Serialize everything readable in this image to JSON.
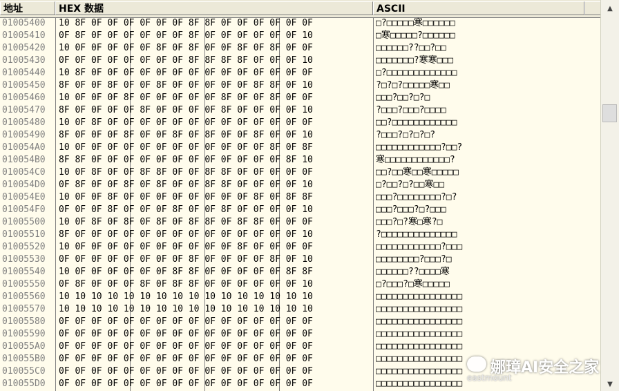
{
  "header": {
    "addr": "地址",
    "hex": "HEX 数据",
    "ascii": "ASCII"
  },
  "rows": [
    {
      "a": "01005400",
      "h": "10 8F 0F 0F 0F 0F 0F 0F 8F 8F 0F 0F 0F 0F 0F 0F",
      "s": "□?□□□□□寒□□□□□□"
    },
    {
      "a": "01005410",
      "h": "0F 8F 0F 0F 0F 0F 0F 0F 8F 0F 0F 0F 0F 0F 0F 10",
      "s": "□寒□□□□□?□□□□□□"
    },
    {
      "a": "01005420",
      "h": "10 0F 0F 0F 0F 0F 8F 0F 8F 0F 0F 8F 0F 8F 0F 0F",
      "s": "□□□□□□??□□?□□"
    },
    {
      "a": "01005430",
      "h": "0F 0F 0F 0F 0F 0F 0F 0F 8F 8F 8F 8F 0F 0F 0F 10",
      "s": "□□□□□□□?寒寒□□□"
    },
    {
      "a": "01005440",
      "h": "10 8F 0F 0F 0F 0F 0F 0F 0F 0F 0F 0F 0F 0F 0F 0F",
      "s": "□?□□□□□□□□□□□□□"
    },
    {
      "a": "01005450",
      "h": "8F 0F 0F 8F 0F 0F 8F 0F 0F 0F 0F 0F 8F 8F 0F 10",
      "s": "?□?□?□□□□□寒□□"
    },
    {
      "a": "01005460",
      "h": "10 0F 0F 0F 8F 0F 0F 0F 0F 0F 8F 0F 0F 8F 0F 0F",
      "s": "□□□?□□?□?□"
    },
    {
      "a": "01005470",
      "h": "8F 0F 0F 0F 0F 8F 0F 0F 0F 0F 8F 0F 0F 0F 0F 10",
      "s": "?□□□?□□□?□□□□"
    },
    {
      "a": "01005480",
      "h": "10 0F 8F 0F 0F 0F 0F 0F 0F 0F 0F 0F 0F 0F 0F 0F",
      "s": "□□?□□□□□□□□□□□□"
    },
    {
      "a": "01005490",
      "h": "8F 0F 0F 0F 8F 0F 0F 8F 0F 8F 0F 0F 8F 0F 0F 10",
      "s": "?□□□?□?□?□?"
    },
    {
      "a": "010054A0",
      "h": "10 0F 0F 0F 0F 0F 0F 0F 0F 0F 0F 0F 0F 8F 0F 8F",
      "s": "□□□□□□□□□□□□?□□?"
    },
    {
      "a": "010054B0",
      "h": "8F 8F 0F 0F 0F 0F 0F 0F 0F 0F 0F 0F 0F 0F 8F 10",
      "s": "寒□□□□□□□□□□□□?"
    },
    {
      "a": "010054C0",
      "h": "10 0F 8F 0F 0F 8F 8F 0F 0F 8F 8F 0F 0F 0F 0F 0F",
      "s": "□□?□□寒□□寒□□□□□"
    },
    {
      "a": "010054D0",
      "h": "0F 8F 0F 0F 8F 0F 8F 0F 0F 8F 8F 0F 0F 0F 0F 10",
      "s": "□?□□?□?□□寒□□"
    },
    {
      "a": "010054E0",
      "h": "10 0F 0F 8F 0F 0F 0F 0F 0F 0F 0F 0F 8F 0F 8F 8F",
      "s": "□□□?□□□□□□□□?□?"
    },
    {
      "a": "010054F0",
      "h": "0F 0F 0F 8F 0F 0F 0F 8F 0F 0F 8F 0F 0F 0F 0F 10",
      "s": "□□□?□□□?□?□□□"
    },
    {
      "a": "01005500",
      "h": "10 0F 8F 0F 8F 0F 8F 0F 8F 8F 0F 8F 8F 0F 0F 0F",
      "s": "□□□?□?寒□寒?□"
    },
    {
      "a": "01005510",
      "h": "8F 0F 0F 0F 0F 0F 0F 0F 0F 0F 0F 0F 0F 0F 0F 10",
      "s": "?□□□□□□□□□□□□□□"
    },
    {
      "a": "01005520",
      "h": "10 0F 0F 0F 0F 0F 0F 0F 0F 0F 0F 8F 0F 0F 0F 0F",
      "s": "□□□□□□□□□□□□?□□□"
    },
    {
      "a": "01005530",
      "h": "0F 0F 0F 0F 0F 0F 0F 0F 8F 0F 0F 0F 0F 8F 0F 10",
      "s": "□□□□□□□□?□□□?□"
    },
    {
      "a": "01005540",
      "h": "10 0F 0F 0F 0F 0F 0F 8F 8F 0F 0F 0F 0F 0F 8F 8F",
      "s": "□□□□□□??□□□□寒"
    },
    {
      "a": "01005550",
      "h": "0F 8F 0F 0F 0F 8F 0F 8F 8F 0F 0F 0F 0F 0F 0F 10",
      "s": "□?□□□?□寒□□□□□"
    },
    {
      "a": "01005560",
      "h": "10 10 10 10 10 10 10 10 10 10 10 10 10 10 10 10",
      "s": "□□□□□□□□□□□□□□□□"
    },
    {
      "a": "01005570",
      "h": "10 10 10 10 10 10 10 10 10 10 10 10 10 10 10 10",
      "s": "□□□□□□□□□□□□□□□□"
    },
    {
      "a": "01005580",
      "h": "0F 0F 0F 0F 0F 0F 0F 0F 0F 0F 0F 0F 0F 0F 0F 0F",
      "s": "□□□□□□□□□□□□□□□□"
    },
    {
      "a": "01005590",
      "h": "0F 0F 0F 0F 0F 0F 0F 0F 0F 0F 0F 0F 0F 0F 0F 0F",
      "s": "□□□□□□□□□□□□□□□□"
    },
    {
      "a": "010055A0",
      "h": "0F 0F 0F 0F 0F 0F 0F 0F 0F 0F 0F 0F 0F 0F 0F 0F",
      "s": "□□□□□□□□□□□□□□□□"
    },
    {
      "a": "010055B0",
      "h": "0F 0F 0F 0F 0F 0F 0F 0F 0F 0F 0F 0F 0F 0F 0F 0F",
      "s": "□□□□□□□□□□□□□□□□"
    },
    {
      "a": "010055C0",
      "h": "0F 0F 0F 0F 0F 0F 0F 0F 0F 0F 0F 0F 0F 0F 0F 0F",
      "s": "□□□□□□□□□□□□□□□□"
    },
    {
      "a": "010055D0",
      "h": "0F 0F 0F 0F 0F 0F 0F 0F 0F 0F 0F 0F 0F 0F 0F 0F",
      "s": "□□□□□□□□□□□□□□□□"
    }
  ],
  "watermark": {
    "title": "娜璋AI安全之家",
    "subtitle": "eastmount"
  },
  "scrollbar": {
    "up_icon": "arrow-up-icon",
    "down_icon": "arrow-down-icon"
  }
}
